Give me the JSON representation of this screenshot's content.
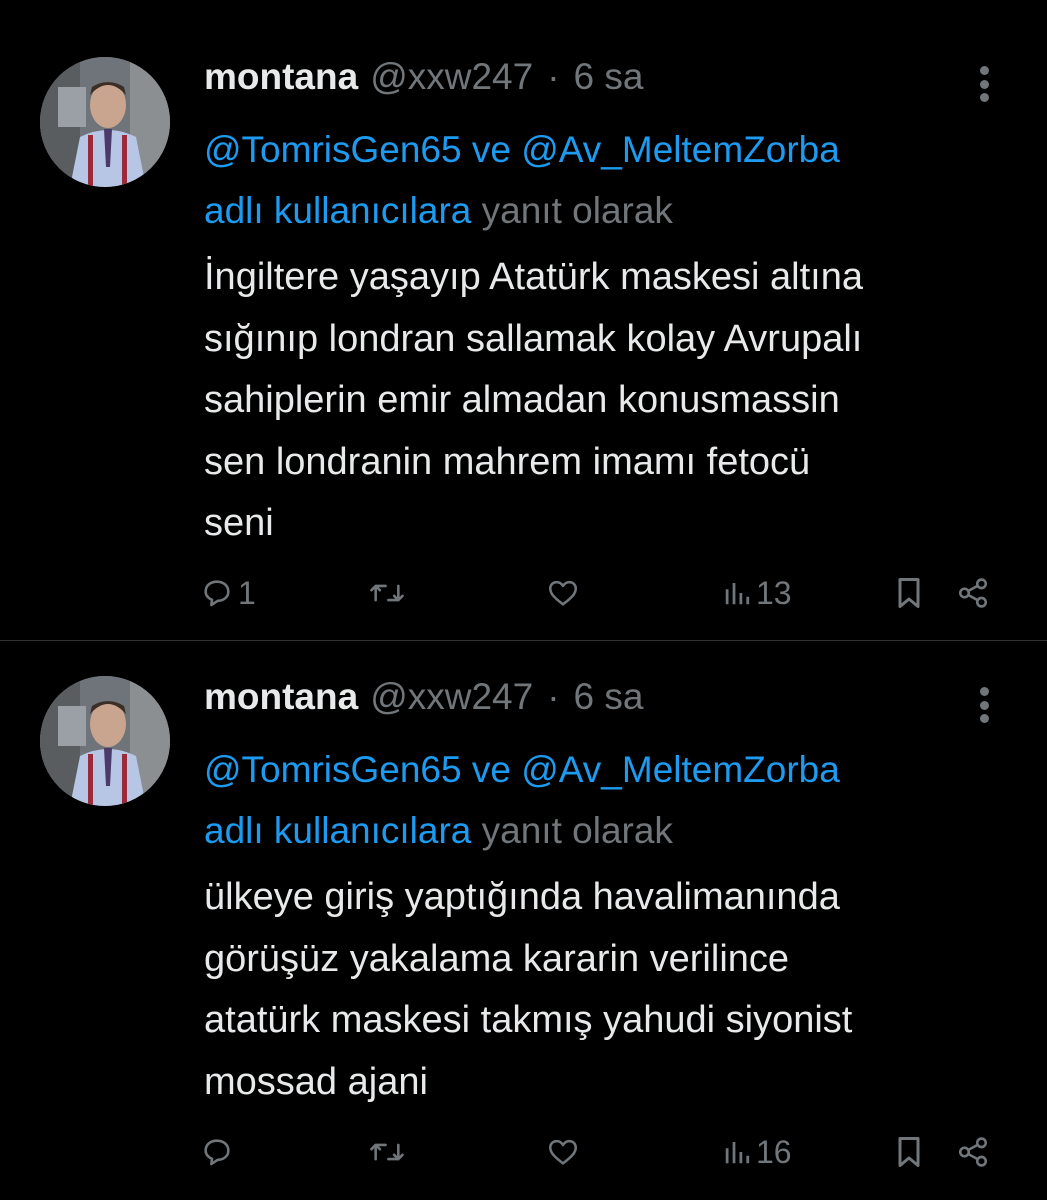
{
  "tweets": [
    {
      "display_name": "montana",
      "handle": "@xxw247",
      "separator": "·",
      "time": "6 sa",
      "mention_1": "@TomrisGen65",
      "connector": "ve",
      "mention_2": "@Av_MeltemZorba",
      "mention_tail": "adlı kullanıcılara",
      "reply_suffix": "yanıt olarak",
      "lines": [
        "İngiltere yaşayıp Atatürk maskesi altına",
        "sığınıp londran sallamak kolay Avrupalı",
        "sahiplerin emir almadan konusmassin",
        "sen londranin mahrem imamı fetocü",
        "seni"
      ],
      "reply_count": "1",
      "views_count": "13"
    },
    {
      "display_name": "montana",
      "handle": "@xxw247",
      "separator": "·",
      "time": "6 sa",
      "mention_1": "@TomrisGen65",
      "connector": "ve",
      "mention_2": "@Av_MeltemZorba",
      "mention_tail": "adlı kullanıcılara",
      "reply_suffix": "yanıt olarak",
      "lines": [
        "ülkeye giriş yaptığında havalimanında",
        "görüşüz yakalama kararin verilince",
        "atatürk maskesi takmış yahudi siyonist",
        "mossad ajani"
      ],
      "reply_count": "",
      "views_count": "16"
    }
  ],
  "icons": {
    "reply": "reply-icon",
    "retweet": "retweet-icon",
    "like": "heart-icon",
    "views": "views-icon",
    "bookmark": "bookmark-icon",
    "share": "share-icon",
    "more": "more-icon"
  },
  "colors": {
    "background": "#000000",
    "text": "#e7e9ea",
    "muted": "#71767b",
    "link": "#1d9bf0",
    "divider": "#2f3336"
  }
}
